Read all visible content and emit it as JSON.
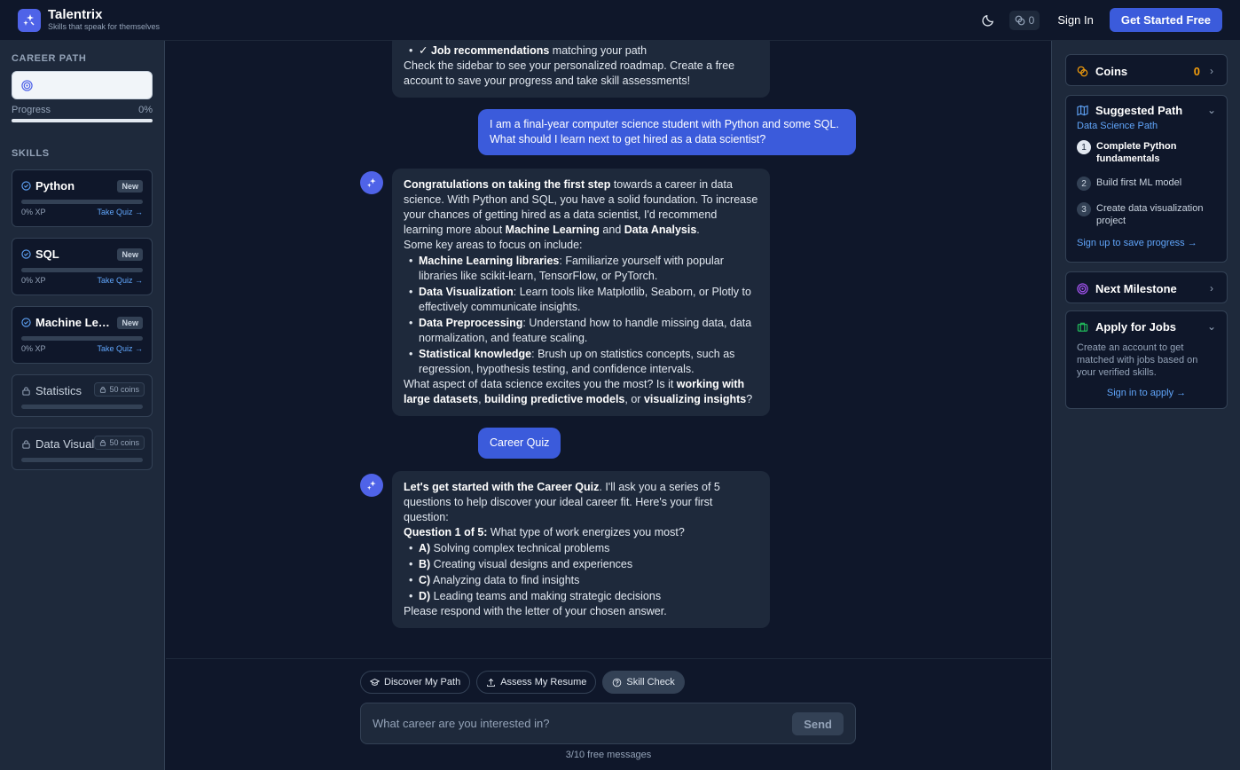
{
  "brand": {
    "name": "Talentrix",
    "tagline": "Skills that speak for themselves"
  },
  "header": {
    "coin_count": "0",
    "sign_in": "Sign In",
    "cta": "Get Started Free"
  },
  "left": {
    "career_path_title": "CAREER PATH",
    "career_path_value": "",
    "progress_label": "Progress",
    "progress_value": "0%",
    "skills_title": "SKILLS",
    "skills": [
      {
        "name": "Python",
        "badge": "New",
        "xp": "0% XP",
        "quiz": "Take Quiz →"
      },
      {
        "name": "SQL",
        "badge": "New",
        "xp": "0% XP",
        "quiz": "Take Quiz →"
      },
      {
        "name": "Machine Learning",
        "badge": "New",
        "xp": "0% XP",
        "quiz": "Take Quiz →"
      },
      {
        "name": "Statistics",
        "coins": "50 coins"
      },
      {
        "name": "Data Visualization",
        "coins": "50 coins"
      }
    ]
  },
  "chat": {
    "top_bubble": {
      "bullet_bold": "✓ Job recommendations",
      "bullet_rest": " matching your path",
      "text": "Check the sidebar to see your personalized roadmap. Create a free account to save your progress and take skill assessments!"
    },
    "user_message_1": "I am a final-year computer science student with Python and some SQL. What should I learn next to get hired as a data scientist?",
    "ai_message_1": {
      "intro_bold": "Congratulations on taking the first step",
      "intro_1": " towards a career in data science. With Python and SQL, you have a solid foundation. To increase your chances of getting hired as a data scientist, I'd recommend learning more about ",
      "ml": "Machine Learning",
      "and": " and ",
      "da": "Data Analysis",
      "period": ".",
      "key_areas": "Some key areas to focus on include:",
      "items": [
        {
          "bold": "Machine Learning libraries",
          "text": ": Familiarize yourself with popular libraries like scikit-learn, TensorFlow, or PyTorch."
        },
        {
          "bold": "Data Visualization",
          "text": ": Learn tools like Matplotlib, Seaborn, or Plotly to effectively communicate insights."
        },
        {
          "bold": "Data Preprocessing",
          "text": ": Understand how to handle missing data, data normalization, and feature scaling."
        },
        {
          "bold": "Statistical knowledge",
          "text": ": Brush up on statistics concepts, such as regression, hypothesis testing, and confidence intervals."
        }
      ],
      "outro_1": "What aspect of data science excites you the most? Is it ",
      "outro_b1": "working with large datasets",
      "outro_c1": ", ",
      "outro_b2": "building predictive models",
      "outro_c2": ", or ",
      "outro_b3": "visualizing insights",
      "outro_end": "?"
    },
    "user_message_2": "Career Quiz",
    "ai_message_2": {
      "intro_bold": "Let's get started with the Career Quiz",
      "intro": ". I'll ask you a series of 5 questions to help discover your ideal career fit. Here's your first question:",
      "q_bold": "Question 1 of 5:",
      "q_text": " What type of work energizes you most?",
      "options": [
        {
          "letter": "A)",
          "text": " Solving complex technical problems"
        },
        {
          "letter": "B)",
          "text": " Creating visual designs and experiences"
        },
        {
          "letter": "C)",
          "text": " Analyzing data to find insights"
        },
        {
          "letter": "D)",
          "text": " Leading teams and making strategic decisions"
        }
      ],
      "outro": "Please respond with the letter of your chosen answer."
    }
  },
  "composer": {
    "chips": [
      "Discover My Path",
      "Assess My Resume",
      "Skill Check"
    ],
    "placeholder": "What career are you interested in?",
    "send": "Send",
    "count": "3/10 free messages"
  },
  "right": {
    "coins_title": "Coins",
    "coins_value": "0",
    "path_title": "Suggested Path",
    "path_sub": "Data Science Path",
    "steps": [
      {
        "num": "1",
        "text": "Complete Python fundamentals"
      },
      {
        "num": "2",
        "text": "Build first ML model"
      },
      {
        "num": "3",
        "text": "Create data visualization project"
      }
    ],
    "signup": "Sign up to save progress →",
    "milestone_title": "Next Milestone",
    "jobs_title": "Apply for Jobs",
    "jobs_text": "Create an account to get matched with jobs based on your verified skills.",
    "jobs_link": "Sign in to apply →"
  },
  "colors": {
    "accent": "#3b5bdb",
    "coin": "#f59e0b",
    "link": "#60a5fa"
  }
}
